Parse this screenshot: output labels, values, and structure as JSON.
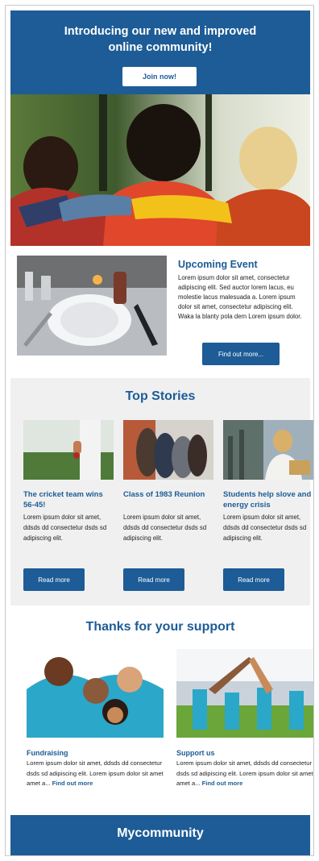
{
  "hero": {
    "title_line1": "Introducing our new and improved",
    "title_line2": "online community!",
    "join_label": "Join now!"
  },
  "event": {
    "heading": "Upcoming Event",
    "body": "Lorem ipsum dolor sit amet, consectetur adipiscing elit. Sed auctor lorem lacus, eu molestie lacus malesuada a. Lorem ipsum dolor sit amet, consectetur adipiscing elit. Waka la blanty pola dem Lorem ipsum dolor.",
    "button_label": "Find out more..."
  },
  "stories": {
    "title": "Top Stories",
    "items": [
      {
        "title": "The cricket team wins 56-45!",
        "text": "Lorem ipsum dolor sit amet,  ddsds dd consectetur dsds sd adipiscing elit.",
        "button": "Read more"
      },
      {
        "title": "Class of 1983 Reunion",
        "text": "Lorem ipsum dolor sit amet,  ddsds dd consectetur dsds sd adipiscing elit.",
        "button": "Read more"
      },
      {
        "title": "Students help slove and energy crisis",
        "text": "Lorem ipsum dolor sit amet,  ddsds dd consectetur dsds sd adipiscing elit.",
        "button": "Read more"
      }
    ]
  },
  "support": {
    "title": "Thanks for your support",
    "items": [
      {
        "title": "Fundraising",
        "text": "Lorem ipsum dolor sit amet,  ddsds dd consectetur dsds sd adipiscing elit. Lorem ipsum dolor sit amet amet a...",
        "link": "Find out more"
      },
      {
        "title": "Support us",
        "text": "Lorem ipsum dolor sit amet,  ddsds dd consectetur dsds sd adipiscing elit. Lorem ipsum dolor sit amet amet a...",
        "link": "Find out more"
      }
    ]
  },
  "footer": {
    "brand": "Mycommunity"
  },
  "colors": {
    "brand_blue": "#1d5c96",
    "section_gray": "#f0f0f0"
  }
}
